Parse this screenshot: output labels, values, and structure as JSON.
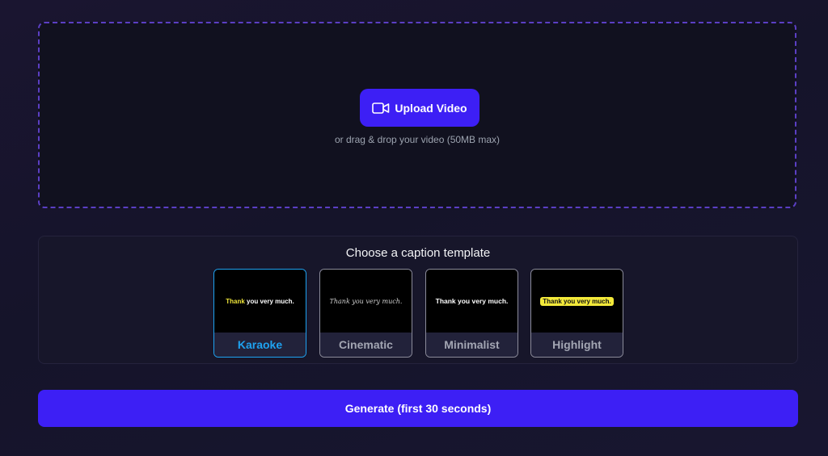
{
  "upload": {
    "button_label": "Upload Video",
    "button_icon": "video-camera-icon",
    "hint": "or drag & drop your video (50MB max)"
  },
  "templates": {
    "title": "Choose a caption template",
    "selected": "Karaoke",
    "items": [
      {
        "label": "Karaoke",
        "preview_highlight": "Thank",
        "preview_rest": " you very much."
      },
      {
        "label": "Cinematic",
        "preview": "Thank you very much."
      },
      {
        "label": "Minimalist",
        "preview": "Thank you very much."
      },
      {
        "label": "Highlight",
        "preview": "Thank you very much."
      }
    ]
  },
  "generate": {
    "label": "Generate (first 30 seconds)"
  },
  "colors": {
    "accent": "#3d1ff5",
    "selected_border": "#1ea2f0",
    "highlight_yellow": "#f3e93a",
    "dropzone_border": "#5b3fc4"
  }
}
